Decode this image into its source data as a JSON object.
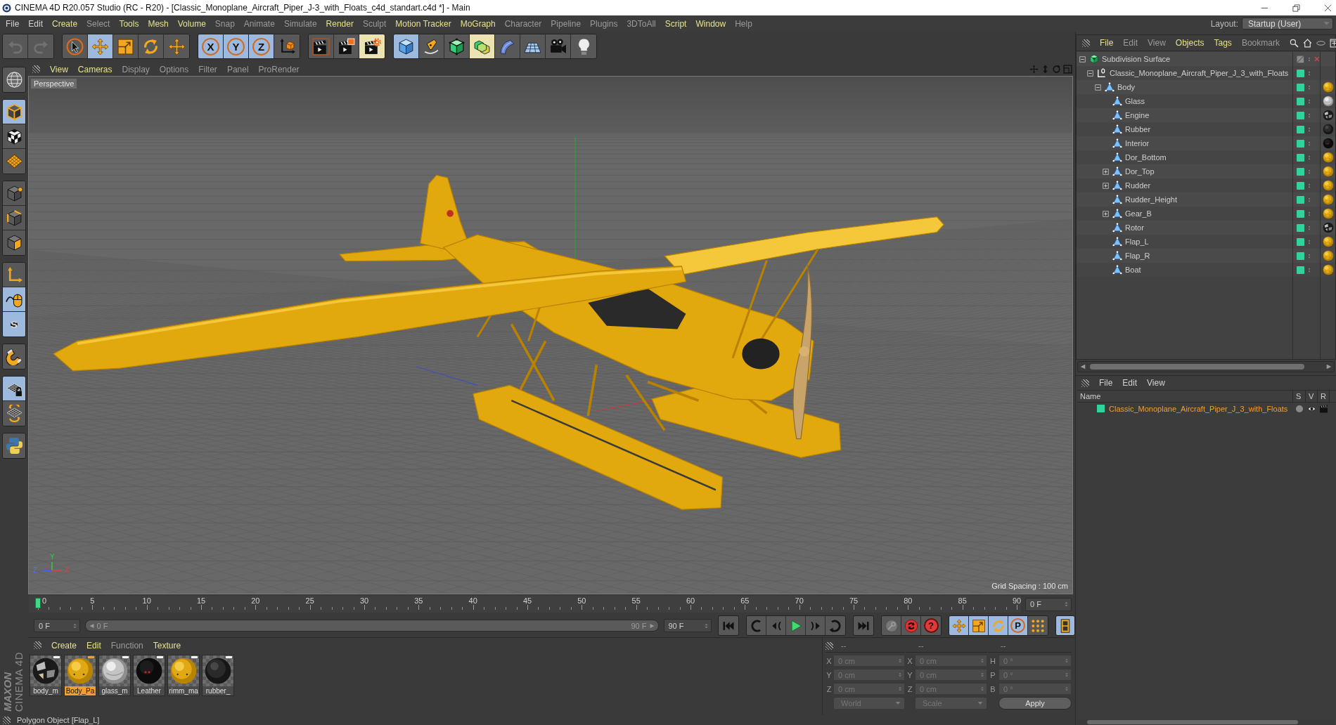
{
  "window": {
    "title": "CINEMA 4D R20.057 Studio (RC - R20) - [Classic_Monoplane_Aircraft_Piper_J-3_with_Floats_c4d_standart.c4d *] - Main"
  },
  "menu_bar": {
    "items": [
      {
        "label": "File",
        "kind": "light"
      },
      {
        "label": "Edit",
        "kind": "light"
      },
      {
        "label": "Create",
        "kind": "accent"
      },
      {
        "label": "Select",
        "kind": "dim"
      },
      {
        "label": "Tools",
        "kind": "accent"
      },
      {
        "label": "Mesh",
        "kind": "accent"
      },
      {
        "label": "Volume",
        "kind": "accent"
      },
      {
        "label": "Snap",
        "kind": "dim"
      },
      {
        "label": "Animate",
        "kind": "dim"
      },
      {
        "label": "Simulate",
        "kind": "dim"
      },
      {
        "label": "Render",
        "kind": "accent"
      },
      {
        "label": "Sculpt",
        "kind": "dim"
      },
      {
        "label": "Motion Tracker",
        "kind": "accent"
      },
      {
        "label": "MoGraph",
        "kind": "accent"
      },
      {
        "label": "Character",
        "kind": "dim"
      },
      {
        "label": "Pipeline",
        "kind": "dim"
      },
      {
        "label": "Plugins",
        "kind": "dim"
      },
      {
        "label": "3DToAll",
        "kind": "dim"
      },
      {
        "label": "Script",
        "kind": "accent"
      },
      {
        "label": "Window",
        "kind": "accent"
      },
      {
        "label": "Help",
        "kind": "dim"
      }
    ],
    "layout_label": "Layout:",
    "layout_value": "Startup (User)"
  },
  "toolbar": {
    "groups": [
      [
        {
          "kind": "undo",
          "active": false,
          "disabled": true,
          "highlighted": false
        },
        {
          "kind": "redo",
          "active": false,
          "disabled": true,
          "highlighted": false
        }
      ],
      [
        {
          "kind": "select",
          "active": false,
          "disabled": false,
          "highlighted": false
        },
        {
          "kind": "move",
          "active": true,
          "disabled": false,
          "highlighted": false
        },
        {
          "kind": "scale",
          "active": false,
          "disabled": false,
          "highlighted": false
        },
        {
          "kind": "rotate",
          "active": false,
          "disabled": false,
          "highlighted": false
        },
        {
          "kind": "recent",
          "active": false,
          "disabled": false,
          "highlighted": false
        }
      ],
      [
        {
          "kind": "axis-lock",
          "label": "X",
          "active": true,
          "disabled": false,
          "highlighted": false
        },
        {
          "kind": "axis-lock",
          "label": "Y",
          "active": true,
          "disabled": false,
          "highlighted": false
        },
        {
          "kind": "axis-lock",
          "label": "Z",
          "active": true,
          "disabled": false,
          "highlighted": false
        },
        {
          "kind": "coordinates",
          "active": false,
          "disabled": false,
          "highlighted": false
        }
      ],
      [
        {
          "kind": "render-view",
          "active": false,
          "disabled": false,
          "highlighted": false
        },
        {
          "kind": "render-picture",
          "active": false,
          "disabled": false,
          "highlighted": false
        },
        {
          "kind": "render-settings",
          "active": false,
          "disabled": false,
          "highlighted": true
        }
      ],
      [
        {
          "kind": "cube",
          "active": true,
          "disabled": false,
          "highlighted": false
        },
        {
          "kind": "pen",
          "active": false,
          "disabled": false,
          "highlighted": false
        },
        {
          "kind": "subdivision",
          "active": false,
          "disabled": false,
          "highlighted": false
        },
        {
          "kind": "array",
          "active": false,
          "disabled": false,
          "highlighted": true
        },
        {
          "kind": "deformer",
          "active": false,
          "disabled": false,
          "highlighted": false
        },
        {
          "kind": "floor",
          "active": false,
          "disabled": false,
          "highlighted": false
        },
        {
          "kind": "camera",
          "active": false,
          "disabled": false,
          "highlighted": false
        },
        {
          "kind": "light",
          "active": false,
          "disabled": false,
          "highlighted": false
        }
      ]
    ]
  },
  "left_toolbar": {
    "groups": [
      [
        {
          "kind": "make-editable",
          "active": false
        }
      ],
      [
        {
          "kind": "model",
          "active": true
        },
        {
          "kind": "texture",
          "active": false
        },
        {
          "kind": "workplane",
          "active": false
        }
      ],
      [
        {
          "kind": "points",
          "active": false
        },
        {
          "kind": "edges",
          "active": false
        },
        {
          "kind": "polygons",
          "active": false
        }
      ],
      [
        {
          "kind": "axis",
          "active": false
        },
        {
          "kind": "tweak",
          "active": true
        },
        {
          "kind": "solo",
          "label": "S",
          "active": true
        }
      ],
      [
        {
          "kind": "snap",
          "active": false
        }
      ],
      [
        {
          "kind": "workplane-lock",
          "active": true
        },
        {
          "kind": "workplane-align",
          "active": false
        }
      ],
      [
        {
          "kind": "script",
          "active": false
        }
      ]
    ]
  },
  "logo": {
    "brand": "MAXON",
    "product": "CINEMA 4D"
  },
  "viewport": {
    "menu": [
      {
        "label": "View",
        "kind": "accent"
      },
      {
        "label": "Cameras",
        "kind": "accent"
      },
      {
        "label": "Display",
        "kind": "dim"
      },
      {
        "label": "Options",
        "kind": "dim"
      },
      {
        "label": "Filter",
        "kind": "dim"
      },
      {
        "label": "Panel",
        "kind": "dim"
      },
      {
        "label": "ProRender",
        "kind": "dim"
      }
    ],
    "camera": "Perspective",
    "grid_spacing": "Grid Spacing : 100 cm",
    "axes": {
      "x": "X",
      "y": "Y",
      "z": "Z"
    }
  },
  "timeline": {
    "ticks": [
      "0",
      "5",
      "10",
      "15",
      "20",
      "25",
      "30",
      "35",
      "40",
      "45",
      "50",
      "55",
      "60",
      "65",
      "70",
      "75",
      "80",
      "85",
      "90"
    ],
    "playhead": {
      "level": 0
    },
    "current_frame": "0 F",
    "start_field": "0 F",
    "range": {
      "start": "0 F",
      "end": "90 F",
      "level": 1
    },
    "end_field": "90 F",
    "transport": [
      [
        {
          "kind": "go-start",
          "active": false
        }
      ],
      [
        {
          "kind": "prev-key",
          "active": false
        },
        {
          "kind": "prev-frame",
          "active": false
        },
        {
          "kind": "play",
          "active": false
        },
        {
          "kind": "next-frame",
          "active": false
        },
        {
          "kind": "next-key",
          "active": false
        }
      ],
      [
        {
          "kind": "go-end",
          "active": false
        }
      ],
      [
        {
          "kind": "autokey",
          "active": false
        },
        {
          "kind": "record",
          "active": false
        },
        {
          "kind": "help",
          "label": "?",
          "active": false
        }
      ],
      [
        {
          "kind": "key-move",
          "active": true
        },
        {
          "kind": "key-scale",
          "active": true
        },
        {
          "kind": "key-rotate",
          "active": true
        },
        {
          "kind": "key-param",
          "label": "P",
          "active": true
        },
        {
          "kind": "key-points",
          "active": false
        }
      ],
      [
        {
          "kind": "timeline",
          "active": true
        }
      ]
    ]
  },
  "materials": {
    "menu": [
      {
        "label": "Create",
        "kind": "accent"
      },
      {
        "label": "Edit",
        "kind": "accent"
      },
      {
        "label": "Function",
        "kind": "dim"
      },
      {
        "label": "Texture",
        "kind": "accent"
      }
    ],
    "items": [
      {
        "name": "body_m",
        "kind": "patchwork",
        "selected": false
      },
      {
        "name": "Body_Pa",
        "kind": "paint",
        "selected": true
      },
      {
        "name": "glass_m",
        "kind": "glass",
        "selected": false
      },
      {
        "name": "Leather",
        "kind": "leather",
        "selected": false
      },
      {
        "name": "rimm_ma",
        "kind": "paint",
        "selected": false
      },
      {
        "name": "rubber_",
        "kind": "rubber",
        "selected": false
      }
    ]
  },
  "coordinates": {
    "disabled": true,
    "headers": [
      "--",
      "--",
      "--"
    ],
    "columns": [
      {
        "fields": [
          {
            "label": "X",
            "value": "0 cm"
          },
          {
            "label": "Y",
            "value": "0 cm"
          },
          {
            "label": "Z",
            "value": "0 cm"
          }
        ],
        "control": {
          "kind": "dropdown",
          "label": "World"
        }
      },
      {
        "fields": [
          {
            "label": "X",
            "value": "0 cm"
          },
          {
            "label": "Y",
            "value": "0 cm"
          },
          {
            "label": "Z",
            "value": "0 cm"
          }
        ],
        "control": {
          "kind": "dropdown",
          "label": "Scale"
        }
      },
      {
        "fields": [
          {
            "label": "H",
            "value": "0 °"
          },
          {
            "label": "P",
            "value": "0 °"
          },
          {
            "label": "B",
            "value": "0 °"
          }
        ],
        "control": {
          "kind": "button",
          "label": "Apply"
        }
      }
    ]
  },
  "object_manager": {
    "menu": [
      {
        "label": "File",
        "kind": "accent"
      },
      {
        "label": "Edit",
        "kind": "dim"
      },
      {
        "label": "View",
        "kind": "dim"
      },
      {
        "label": "Objects",
        "kind": "accent"
      },
      {
        "label": "Tags",
        "kind": "accent"
      },
      {
        "label": "Bookmark",
        "kind": "dim"
      }
    ],
    "tree": [
      {
        "name": "Subdivision Surface",
        "kind": "subdivision",
        "expanded": true,
        "layer": false,
        "enabled": false,
        "children": [
          {
            "name": "Classic_Monoplane_Aircraft_Piper_J_3_with_Floats",
            "kind": "null",
            "expanded": true,
            "layer": true,
            "children": [
              {
                "name": "Body",
                "kind": "polygon",
                "expanded": true,
                "layer": true,
                "tag": {
                  "kind": "paint"
                },
                "children": [
                  {
                    "name": "Glass",
                    "kind": "polygon",
                    "layer": true,
                    "tag": {
                      "kind": "glass"
                    }
                  },
                  {
                    "name": "Engine",
                    "kind": "polygon",
                    "layer": true,
                    "tag": {
                      "kind": "patchwork"
                    }
                  },
                  {
                    "name": "Rubber",
                    "kind": "polygon",
                    "layer": true,
                    "tag": {
                      "kind": "rubber"
                    }
                  },
                  {
                    "name": "Interior",
                    "kind": "polygon",
                    "layer": true,
                    "tag": {
                      "kind": "leather"
                    }
                  },
                  {
                    "name": "Dor_Bottom",
                    "kind": "polygon",
                    "layer": true,
                    "tag": {
                      "kind": "paint"
                    }
                  },
                  {
                    "name": "Dor_Top",
                    "kind": "polygon",
                    "expanded": false,
                    "layer": true,
                    "tag": {
                      "kind": "paint"
                    }
                  },
                  {
                    "name": "Rudder",
                    "kind": "polygon",
                    "expanded": false,
                    "layer": true,
                    "tag": {
                      "kind": "paint"
                    }
                  },
                  {
                    "name": "Rudder_Height",
                    "kind": "polygon",
                    "layer": true,
                    "tag": {
                      "kind": "paint"
                    }
                  },
                  {
                    "name": "Gear_B",
                    "kind": "polygon",
                    "expanded": false,
                    "layer": true,
                    "tag": {
                      "kind": "paint"
                    }
                  },
                  {
                    "name": "Rotor",
                    "kind": "polygon",
                    "layer": true,
                    "tag": {
                      "kind": "patchwork"
                    }
                  },
                  {
                    "name": "Flap_L",
                    "kind": "polygon",
                    "layer": true,
                    "tag": {
                      "kind": "paint"
                    }
                  },
                  {
                    "name": "Flap_R",
                    "kind": "polygon",
                    "layer": true,
                    "tag": {
                      "kind": "paint"
                    }
                  },
                  {
                    "name": "Boat",
                    "kind": "polygon",
                    "layer": true,
                    "tag": {
                      "kind": "paint"
                    }
                  }
                ]
              }
            ]
          }
        ]
      }
    ]
  },
  "layer_manager": {
    "menu": [
      {
        "label": "File",
        "kind": "light"
      },
      {
        "label": "Edit",
        "kind": "light"
      },
      {
        "label": "View",
        "kind": "light"
      }
    ],
    "columns": [
      "Name",
      "S",
      "V",
      "R"
    ],
    "rows": [
      {
        "name": "Classic_Monoplane_Aircraft_Piper_J_3_with_Floats",
        "color": "#2fd39c",
        "solo": false,
        "visible": true,
        "render": true
      }
    ]
  },
  "status_bar": {
    "text": "Polygon Object [Flap_L]"
  }
}
